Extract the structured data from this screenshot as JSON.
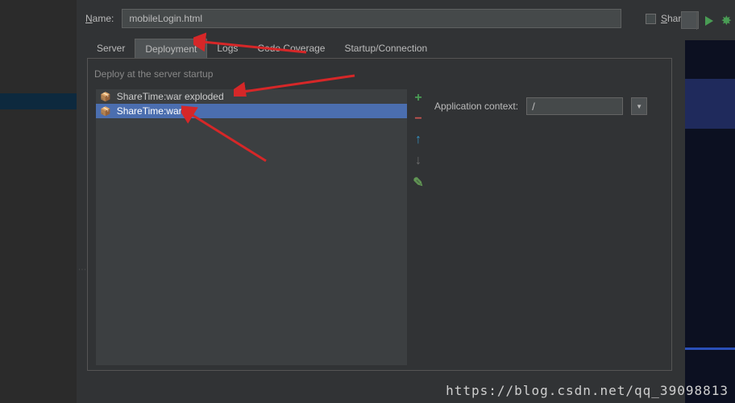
{
  "header": {
    "name_label_pre": "N",
    "name_label_rest": "ame:",
    "name_value": "mobileLogin.html",
    "share_pre": "S",
    "share_rest": "hare"
  },
  "tabs": {
    "server": "Server",
    "deployment": "Deployment",
    "logs": "Logs",
    "codecoverage": "Code Coverage",
    "startup": "Startup/Connection"
  },
  "panel": {
    "deploy_label": "Deploy at the server startup",
    "items": [
      "ShareTime:war exploded",
      "ShareTime:war"
    ],
    "app_ctx_label": "Application context:",
    "app_ctx_value": "/"
  },
  "watermark": "https://blog.csdn.net/qq_39098813"
}
